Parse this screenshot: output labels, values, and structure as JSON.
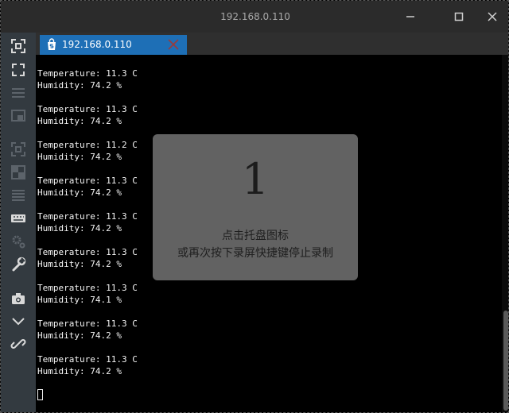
{
  "window": {
    "title": "192.168.0.110"
  },
  "tab": {
    "label": "192.168.0.110",
    "icon": "session-s-icon"
  },
  "sidebar": {
    "icons": [
      "screenshot-icon",
      "fullscreen-icon",
      "menu-icon",
      "window-icon",
      "capture-icon",
      "grid-icon",
      "list-icon",
      "keyboard-icon",
      "settings-icon",
      "wrench-icon",
      "camera-icon",
      "chevron-down-icon",
      "link-icon"
    ]
  },
  "terminal": {
    "entries": [
      {
        "temperature": "Temperature: 11.3 C",
        "humidity": "Humidity: 74.2 %"
      },
      {
        "temperature": "Temperature: 11.3 C",
        "humidity": "Humidity: 74.2 %"
      },
      {
        "temperature": "Temperature: 11.2 C",
        "humidity": "Humidity: 74.2 %"
      },
      {
        "temperature": "Temperature: 11.3 C",
        "humidity": "Humidity: 74.2 %"
      },
      {
        "temperature": "Temperature: 11.3 C",
        "humidity": "Humidity: 74.2 %"
      },
      {
        "temperature": "Temperature: 11.3 C",
        "humidity": "Humidity: 74.2 %"
      },
      {
        "temperature": "Temperature: 11.3 C",
        "humidity": "Humidity: 74.1 %"
      },
      {
        "temperature": "Temperature: 11.3 C",
        "humidity": "Humidity: 74.2 %"
      },
      {
        "temperature": "Temperature: 11.3 C",
        "humidity": "Humidity: 74.2 %"
      }
    ]
  },
  "overlay": {
    "countdown": "1",
    "line1": "点击托盘图标",
    "line2": "或再次按下录屏快捷键停止录制"
  },
  "colors": {
    "tab_active": "#1e6fb6",
    "sidebar": "#333a40",
    "titlebar": "#2b2b2b",
    "terminal_bg": "#000000"
  }
}
